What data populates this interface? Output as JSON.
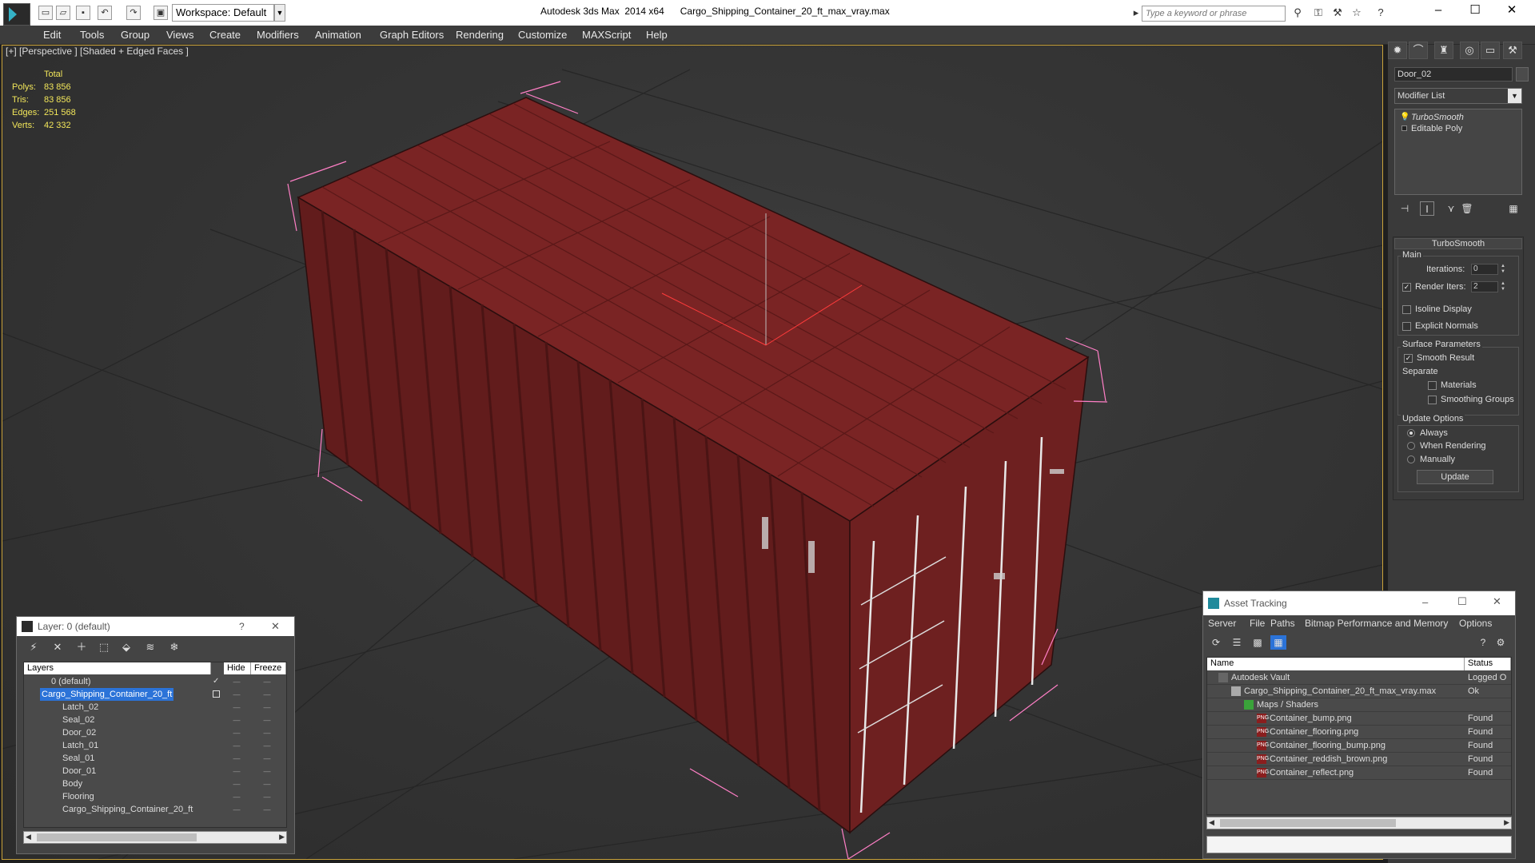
{
  "titlebar": {
    "workspace": "Workspace: Default",
    "title": "Autodesk 3ds Max  2014 x64      Cargo_Shipping_Container_20_ft_max_vray.max",
    "search_placeholder": "Type a keyword or phrase"
  },
  "menu": [
    "Edit",
    "Tools",
    "Group",
    "Views",
    "Create",
    "Modifiers",
    "Animation",
    "Graph Editors",
    "Rendering",
    "Customize",
    "MAXScript",
    "Help"
  ],
  "viewport": {
    "label": "[+] [Perspective ] [Shaded + Edged Faces ]",
    "stats": {
      "header": "Total",
      "rows": [
        {
          "k": "Polys:",
          "v": "83 856"
        },
        {
          "k": "Tris:",
          "v": "83 856"
        },
        {
          "k": "Edges:",
          "v": "251 568"
        },
        {
          "k": "Verts:",
          "v": "42 332"
        }
      ]
    }
  },
  "command_panel": {
    "object_name": "Door_02",
    "modifier_list": "Modifier List",
    "stack": [
      "TurboSmooth",
      "Editable Poly"
    ],
    "rollout_title": "TurboSmooth",
    "main_label": "Main",
    "iterations_label": "Iterations:",
    "iterations_value": "0",
    "render_iters_label": "Render Iters:",
    "render_iters_value": "2",
    "isoline": "Isoline Display",
    "explicit_normals": "Explicit Normals",
    "surface_params": "Surface Parameters",
    "smooth_result": "Smooth Result",
    "separate": "Separate",
    "materials": "Materials",
    "smoothing_groups": "Smoothing Groups",
    "update_options": "Update Options",
    "always": "Always",
    "when_rendering": "When Rendering",
    "manually": "Manually",
    "update_button": "Update"
  },
  "layer_dialog": {
    "title": "Layer: 0 (default)",
    "help": "?",
    "close": "✕",
    "col_layers": "Layers",
    "col_hide": "Hide",
    "col_freeze": "Freeze",
    "rows": [
      {
        "name": "0 (default)",
        "indent": 0
      },
      {
        "name": "Cargo_Shipping_Container_20_ft",
        "indent": 0
      },
      {
        "name": "Latch_02",
        "indent": 1
      },
      {
        "name": "Seal_02",
        "indent": 1
      },
      {
        "name": "Door_02",
        "indent": 1
      },
      {
        "name": "Latch_01",
        "indent": 1
      },
      {
        "name": "Seal_01",
        "indent": 1
      },
      {
        "name": "Door_01",
        "indent": 1
      },
      {
        "name": "Body",
        "indent": 1
      },
      {
        "name": "Flooring",
        "indent": 1
      },
      {
        "name": "Cargo_Shipping_Container_20_ft",
        "indent": 1
      }
    ]
  },
  "asset_dialog": {
    "title": "Asset Tracking",
    "menu": [
      "Server",
      "File",
      "Paths",
      "Bitmap Performance and Memory",
      "Options"
    ],
    "col_name": "Name",
    "col_status": "Status",
    "rows": [
      {
        "name": "Autodesk Vault",
        "status": "Logged O",
        "indent": 0,
        "icon": "vault-icon"
      },
      {
        "name": "Cargo_Shipping_Container_20_ft_max_vray.max",
        "status": "Ok",
        "indent": 1,
        "icon": "max-file-icon"
      },
      {
        "name": "Maps / Shaders",
        "status": "",
        "indent": 2,
        "icon": "maps-icon"
      },
      {
        "name": "Container_bump.png",
        "status": "Found",
        "indent": 3,
        "icon": "png-icon"
      },
      {
        "name": "Container_flooring.png",
        "status": "Found",
        "indent": 3,
        "icon": "png-icon"
      },
      {
        "name": "Container_flooring_bump.png",
        "status": "Found",
        "indent": 3,
        "icon": "png-icon"
      },
      {
        "name": "Container_reddish_brown.png",
        "status": "Found",
        "indent": 3,
        "icon": "png-icon"
      },
      {
        "name": "Container_reflect.png",
        "status": "Found",
        "indent": 3,
        "icon": "png-icon"
      }
    ]
  },
  "colors": {
    "container": "#7a2424",
    "selection_bbox": "#ff7fc6",
    "stats_text": "#f2e65a",
    "viewport_border": "#c9a23a",
    "selection_highlight": "#2b73d8"
  }
}
